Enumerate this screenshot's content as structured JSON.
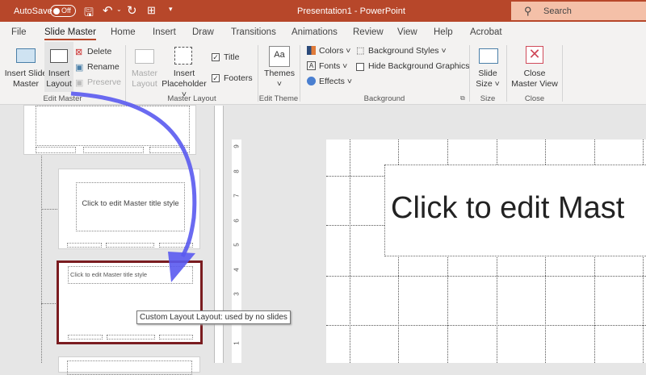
{
  "titlebar": {
    "autosave_label": "AutoSave",
    "autosave_state": "Off",
    "title": "Presentation1  -  PowerPoint",
    "search_placeholder": "Search",
    "color": "#b7472a"
  },
  "tabs": [
    {
      "label": "File"
    },
    {
      "label": "Slide Master",
      "active": true
    },
    {
      "label": "Home"
    },
    {
      "label": "Insert"
    },
    {
      "label": "Draw"
    },
    {
      "label": "Transitions"
    },
    {
      "label": "Animations"
    },
    {
      "label": "Review"
    },
    {
      "label": "View"
    },
    {
      "label": "Help"
    },
    {
      "label": "Acrobat"
    }
  ],
  "ribbon": {
    "edit_master": {
      "group": "Edit Master",
      "insert_slide_master": "Insert Slide Master",
      "insert_layout": "Insert Layout",
      "delete": "Delete",
      "rename": "Rename",
      "preserve": "Preserve"
    },
    "master_layout": {
      "group": "Master Layout",
      "master_layout": "Master Layout",
      "insert_placeholder": "Insert Placeholder",
      "title": "Title",
      "title_checked": true,
      "footers": "Footers",
      "footers_checked": true
    },
    "edit_theme": {
      "group": "Edit Theme",
      "themes": "Themes"
    },
    "background": {
      "group": "Background",
      "colors": "Colors",
      "fonts": "Fonts",
      "effects": "Effects",
      "background_styles": "Background Styles",
      "hide_background_graphics": "Hide Background Graphics",
      "hide_checked": false
    },
    "size": {
      "group": "Size",
      "slide_size": "Slide Size"
    },
    "close": {
      "group": "Close",
      "close_master_view": "Close Master View"
    }
  },
  "thumbnails": {
    "title_text": "Click to edit Master title style"
  },
  "tooltip": "Custom Layout Layout: used by no slides",
  "ruler": [
    "9",
    "8",
    "7",
    "6",
    "5",
    "4",
    "3",
    "2",
    "1"
  ],
  "slide": {
    "title": "Click to edit Mast"
  },
  "annotation_arrow_color": "#5a5af0"
}
